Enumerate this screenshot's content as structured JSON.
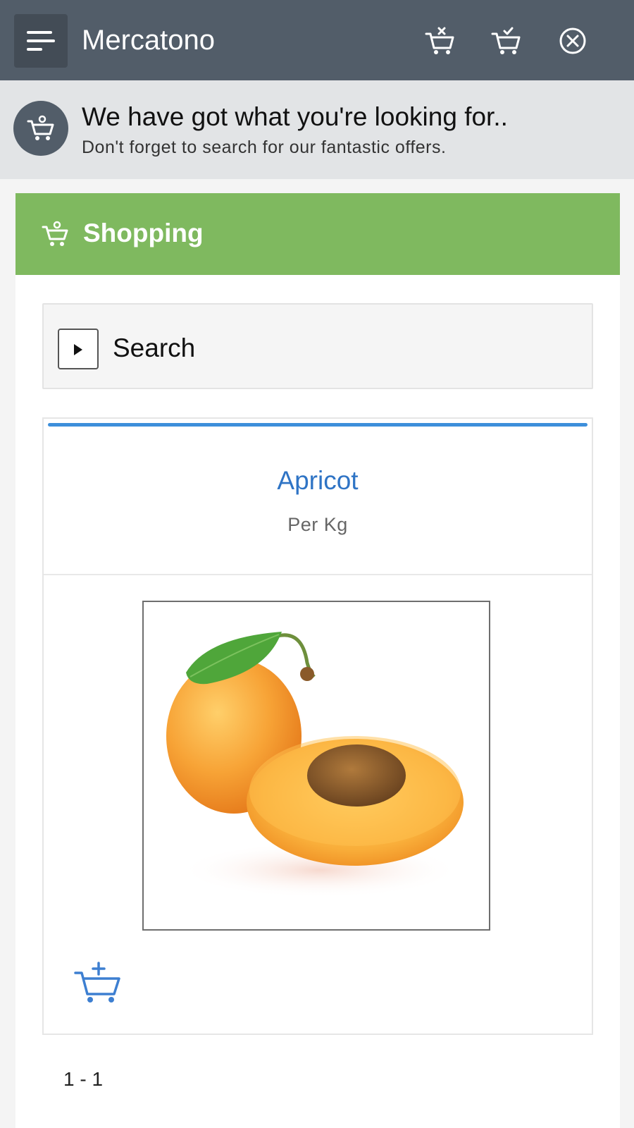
{
  "header": {
    "title": "Mercatono",
    "menu_icon": "menu-icon",
    "actions": [
      {
        "name": "clear-cart-icon"
      },
      {
        "name": "checkout-cart-icon"
      },
      {
        "name": "close-circle-icon"
      }
    ],
    "background": "#525d69"
  },
  "banner": {
    "title": "We have got what you're looking for..",
    "subtitle": "Don't forget to search for our fantastic offers.",
    "icon": "shopping-cart-icon"
  },
  "panel": {
    "title": "Shopping",
    "icon": "shopping-cart-icon",
    "header_color": "#7fb95f"
  },
  "search": {
    "label": "Search",
    "toggle_icon": "play-triangle-icon"
  },
  "product": {
    "name": "Apricot",
    "unit": "Per Kg",
    "image": "apricot-photo",
    "add_icon": "add-to-cart-icon",
    "accent_color": "#3d8fdb"
  },
  "pagination": {
    "range": "1 - 1"
  }
}
